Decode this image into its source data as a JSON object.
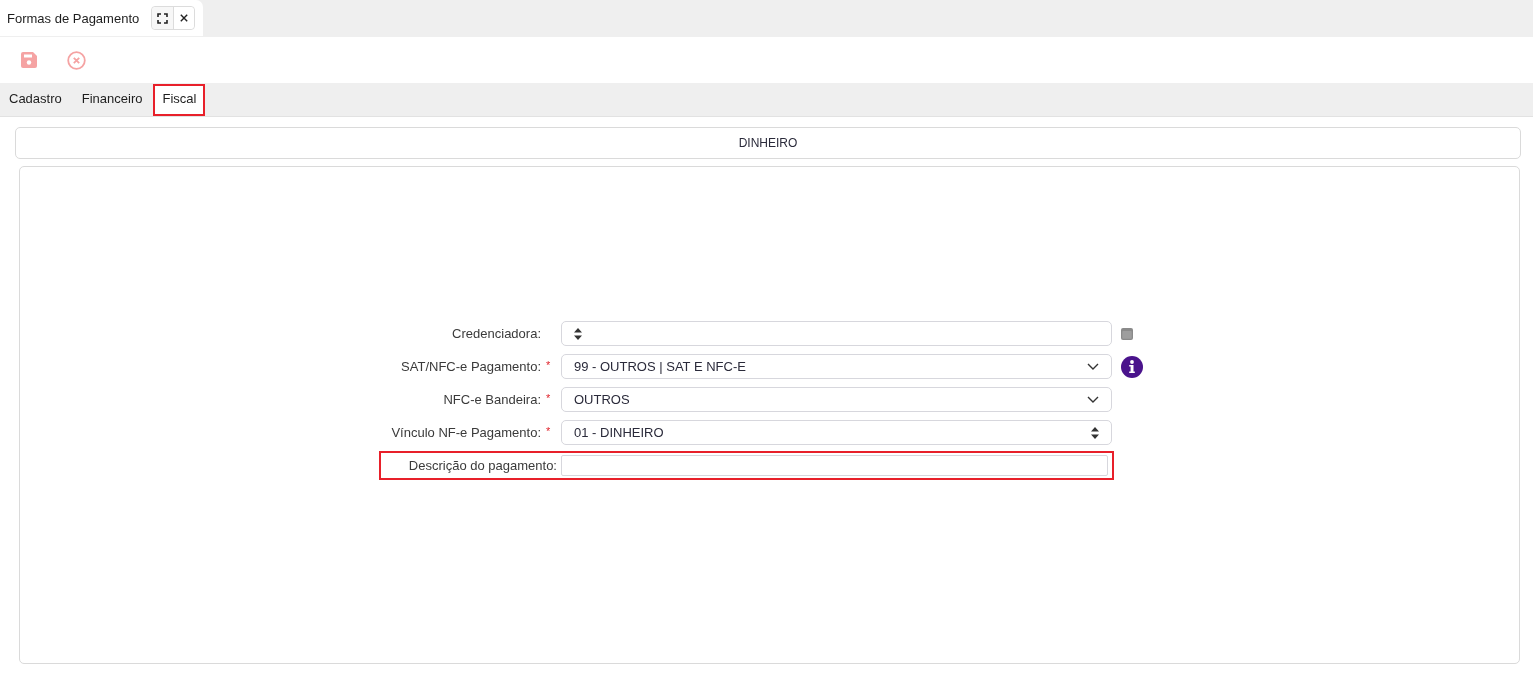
{
  "window_tab": {
    "title": "Formas de Pagamento"
  },
  "toolbar": [
    {
      "kind": "save"
    },
    {
      "kind": "cancel"
    }
  ],
  "tabs": [
    {
      "label": "Cadastro",
      "selected": false,
      "highlighted": false
    },
    {
      "label": "Financeiro",
      "selected": false,
      "highlighted": false
    },
    {
      "label": "Fiscal",
      "selected": true,
      "highlighted": true
    }
  ],
  "record_header": {
    "title": "DINHEIRO"
  },
  "form": {
    "required_marker": "*",
    "fields": [
      {
        "label": "Credenciadora:",
        "kind": "spinner",
        "required": false,
        "highlighted": false,
        "addon": {
          "kind": "browse"
        }
      },
      {
        "label": "SAT/NFC-e Pagamento:",
        "kind": "dropdown",
        "value": "99 - OUTROS | SAT E NFC-E",
        "required": true,
        "highlighted": false,
        "addon": {
          "kind": "info"
        }
      },
      {
        "label": "NFC-e Bandeira:",
        "kind": "dropdown",
        "value": "OUTROS",
        "required": true,
        "highlighted": false
      },
      {
        "label": "Vínculo NF-e Pagamento:",
        "kind": "spinner",
        "value": "01 - DINHEIRO",
        "required": true,
        "highlighted": false
      },
      {
        "label": "Descrição do pagamento:",
        "kind": "text",
        "required": false,
        "highlighted": true
      }
    ]
  }
}
